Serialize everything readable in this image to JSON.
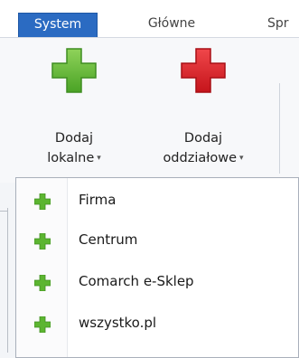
{
  "tabs": [
    {
      "label": "System",
      "active": true
    },
    {
      "label": "Główne",
      "active": false
    },
    {
      "label": "Spr",
      "active": false
    }
  ],
  "ribbon": {
    "add_local": {
      "line1": "Dodaj",
      "line2": "lokalne",
      "icon": "green-plus-icon"
    },
    "add_branch": {
      "line1": "Dodaj",
      "line2": "oddziałowe",
      "icon": "red-plus-icon"
    },
    "dropdown_arrow": "▾"
  },
  "menu": {
    "items": [
      {
        "label": "Firma",
        "icon": "green-plus-icon"
      },
      {
        "label": "Centrum",
        "icon": "green-plus-icon"
      },
      {
        "label": "Comarch e-Sklep",
        "icon": "green-plus-icon"
      },
      {
        "label": "wszystko.pl",
        "icon": "green-plus-icon"
      }
    ]
  },
  "colors": {
    "active_tab": "#2b6bc2",
    "green_plus": "#5cb531",
    "red_plus": "#d9262c"
  }
}
